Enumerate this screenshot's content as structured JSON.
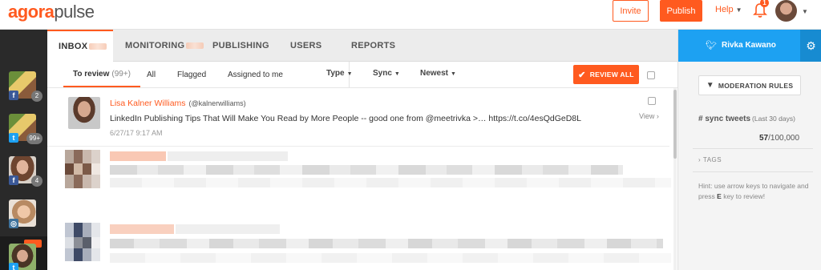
{
  "app": {
    "logo_main": "agora",
    "logo_sub": "pulse",
    "invite_label": "Invite",
    "publish_label": "Publish",
    "help_label": "Help",
    "notification_count": "1"
  },
  "rail": {
    "accounts": [
      {
        "network": "facebook",
        "count": "2"
      },
      {
        "network": "twitter",
        "count": "99+"
      },
      {
        "network": "facebook",
        "count": "4"
      },
      {
        "network": "instagram",
        "count": ""
      },
      {
        "network": "twitter",
        "count": ""
      }
    ]
  },
  "tabs": [
    {
      "label": "INBOX",
      "active": true
    },
    {
      "label": "MONITORING",
      "active": false
    },
    {
      "label": "PUBLISHING",
      "active": false
    },
    {
      "label": "USERS",
      "active": false
    },
    {
      "label": "REPORTS",
      "active": false
    }
  ],
  "filters": {
    "tabs": [
      {
        "label": "To review",
        "count": "(99+)"
      },
      {
        "label": "All",
        "count": ""
      },
      {
        "label": "Flagged",
        "count": ""
      },
      {
        "label": "Assigned to me",
        "count": ""
      }
    ],
    "dropdowns": [
      "Type",
      "Sync",
      "Newest"
    ],
    "review_all_label": "REVIEW ALL"
  },
  "feed": {
    "first_item": {
      "author": "Lisa Kalner Williams",
      "handle": "(@kalnerwilliams)",
      "text": "LinkedIn Publishing Tips That Will Make You Read by More People -- good one from @meetrivka >… https://t.co/4esQdGeD8L",
      "timestamp": "6/27/17 9:17 AM",
      "view_label": "View"
    }
  },
  "right_panel": {
    "account_name": "Rivka Kawano",
    "moderation_rules_label": "MODERATION RULES",
    "sync_title": "# sync tweets",
    "sync_period": "(Last 30 days)",
    "sync_used": "57",
    "sync_total": "/100,000",
    "tags_label": "TAGS",
    "hint_part1": "Hint: use arrow keys to navigate and press ",
    "hint_key": "E",
    "hint_part2": " key to review!"
  },
  "colors": {
    "brand": "#ff5a1f",
    "twitter": "#1da1f2",
    "rail": "#2a2a2a"
  },
  "icons": [
    "bell-icon",
    "twitter-bird-icon",
    "gear-icon",
    "filter-icon",
    "check-icon",
    "chevron-right-icon"
  ]
}
